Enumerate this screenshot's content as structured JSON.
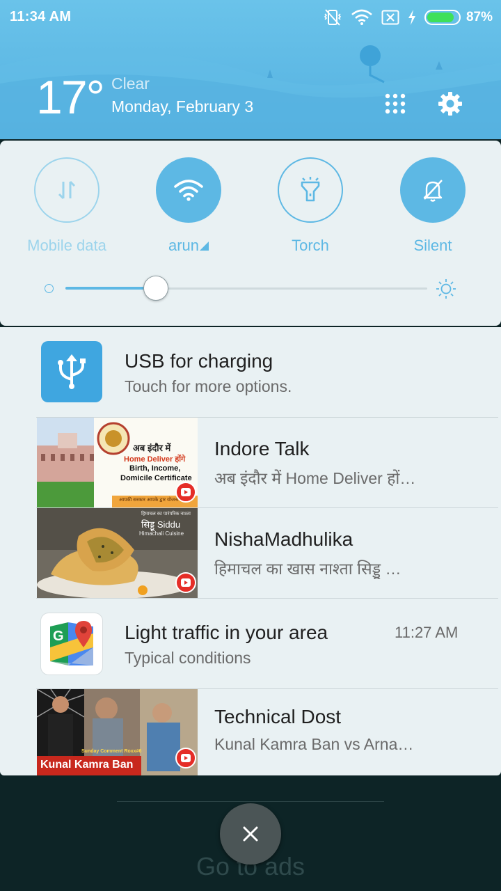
{
  "status_bar": {
    "time": "11:34 AM",
    "battery_pct": "87%",
    "battery_level": 0.87,
    "icons": [
      "vibrate-off-icon",
      "wifi-icon",
      "no-sim-icon",
      "charging-bolt-icon",
      "battery-icon"
    ]
  },
  "weather": {
    "temperature": "17°",
    "condition": "Clear",
    "date": "Monday, February 3"
  },
  "header_actions": [
    "apps-grid-icon",
    "settings-gear-icon"
  ],
  "quick_settings": {
    "toggles": [
      {
        "label": "Mobile data",
        "icon": "mobile-data-icon",
        "state": "off"
      },
      {
        "label": "arun",
        "icon": "wifi-icon",
        "state": "on"
      },
      {
        "label": "Torch",
        "icon": "torch-icon",
        "state": "off"
      },
      {
        "label": "Silent",
        "icon": "silent-bell-icon",
        "state": "on"
      }
    ],
    "brightness_level": 0.25
  },
  "notifications": [
    {
      "title": "USB for charging",
      "subtitle": "Touch for more options.",
      "icon": "usb-icon"
    },
    {
      "title": "Indore Talk",
      "subtitle": "अब इंदौर में Home Deliver हों…",
      "thumb_text": [
        "अब इंदौर में",
        "Home Deliver होंगे",
        "Birth, Income,",
        "Domicile Certificate",
        "आपकी सरकार आपके द्वार योजना"
      ]
    },
    {
      "title": "NishaMadhulika",
      "subtitle": "हिमाचल का खास नाश्ता सिड्डू …",
      "thumb_text": [
        "हिमाचल का पारंपरिक नाश्ता",
        "सिड्डू Siddu",
        "Himachali Cuisine"
      ]
    },
    {
      "title": "Light traffic in your area",
      "subtitle": "Typical conditions",
      "time": "11:27 AM",
      "icon": "maps-icon"
    },
    {
      "title": "Technical Dost",
      "subtitle": "Kunal Kamra Ban vs Arna…",
      "thumb_text": [
        "Kunal Kamra Ban",
        "Sunday Comment Roxx#6"
      ]
    }
  ],
  "bottom": {
    "ads_label": "Go to ads",
    "close_icon": "close-icon"
  }
}
